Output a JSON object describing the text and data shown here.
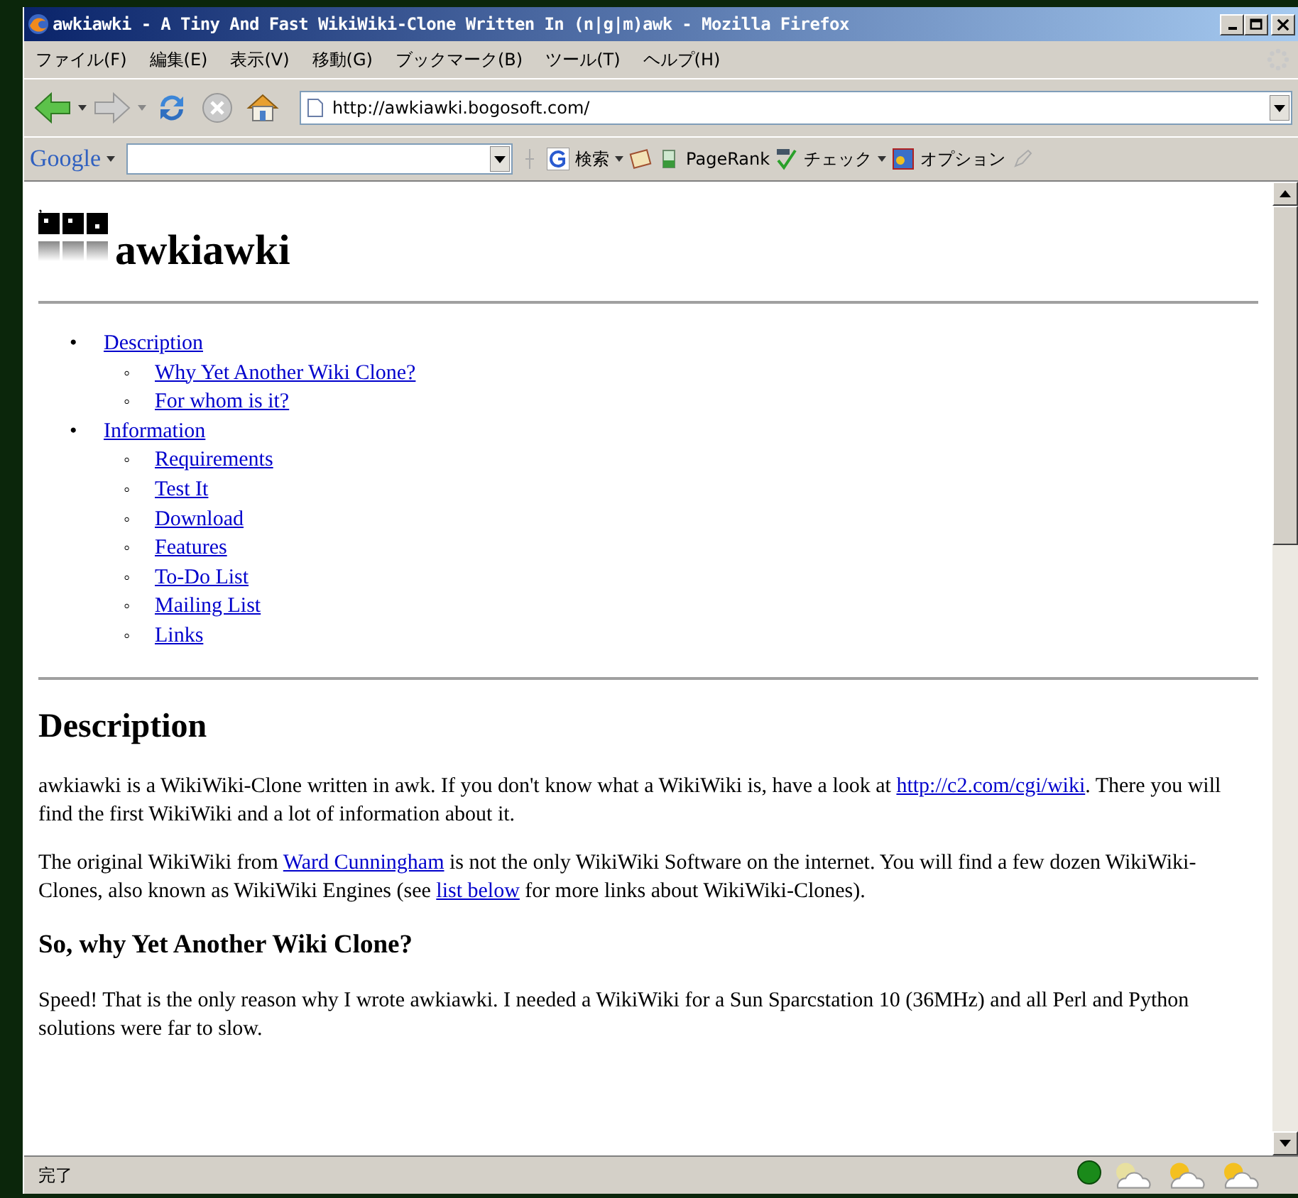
{
  "window": {
    "title": "awkiawki - A Tiny And Fast WikiWiki-Clone Written In (n|g|m)awk - Mozilla Firefox"
  },
  "menu": [
    "ファイル(F)",
    "編集(E)",
    "表示(V)",
    "移動(G)",
    "ブックマーク(B)",
    "ツール(T)",
    "ヘルプ(H)"
  ],
  "address": {
    "value": "http://awkiawki.bogosoft.com/"
  },
  "google_bar": {
    "logo": "Google",
    "search_label": "検索",
    "pagerank": "PageRank",
    "check": "チェック",
    "options": "オプション"
  },
  "page": {
    "stray_mark": ",",
    "site_title": "awkiawki",
    "toc": [
      {
        "marker": "•",
        "label": "Description",
        "children": [
          {
            "marker": "◦",
            "label": "Why Yet Another Wiki Clone?"
          },
          {
            "marker": "◦",
            "label": "For whom is it?"
          }
        ]
      },
      {
        "marker": "•",
        "label": "Information",
        "children": [
          {
            "marker": "◦",
            "label": "Requirements"
          },
          {
            "marker": "◦",
            "label": "Test It"
          },
          {
            "marker": "◦",
            "label": "Download"
          },
          {
            "marker": "◦",
            "label": "Features"
          },
          {
            "marker": "◦",
            "label": "To-Do List"
          },
          {
            "marker": "◦",
            "label": "Mailing List"
          },
          {
            "marker": "◦",
            "label": "Links"
          }
        ]
      }
    ],
    "sections": [
      {
        "kind": "h2",
        "text": "Description"
      },
      {
        "kind": "p",
        "parts": [
          {
            "kind": "text",
            "text": "awkiawki is a WikiWiki-Clone written in awk. If you don't know what a WikiWiki is, have a look at "
          },
          {
            "kind": "link",
            "text": "http://c2.com/cgi/wiki"
          },
          {
            "kind": "text",
            "text": ". There you will find the first WikiWiki and a lot of information about it."
          }
        ]
      },
      {
        "kind": "p",
        "parts": [
          {
            "kind": "text",
            "text": "The original WikiWiki from "
          },
          {
            "kind": "link",
            "text": "Ward Cunningham"
          },
          {
            "kind": "text",
            "text": " is not the only WikiWiki Software on the internet. You will find a few dozen WikiWiki-Clones, also known as WikiWiki Engines (see "
          },
          {
            "kind": "link",
            "text": "list below"
          },
          {
            "kind": "text",
            "text": " for more links about WikiWiki-Clones)."
          }
        ]
      },
      {
        "kind": "h3",
        "text": "So, why Yet Another Wiki Clone?"
      },
      {
        "kind": "p",
        "parts": [
          {
            "kind": "text",
            "text": "Speed! That is the only reason why I wrote awkiawki. I needed a WikiWiki for a Sun Sparcstation 10 (36MHz) and all Perl and Python solutions were far to slow."
          }
        ]
      }
    ]
  },
  "status_bar": {
    "text": "完了"
  }
}
